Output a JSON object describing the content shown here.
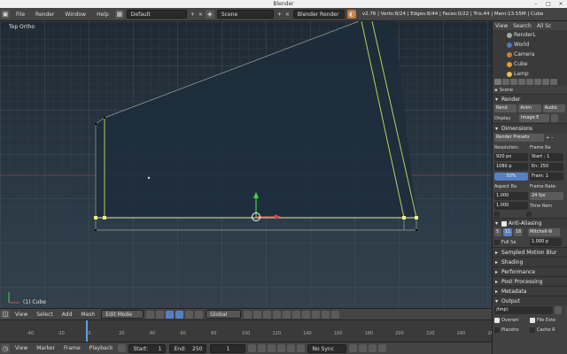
{
  "window": {
    "title": "Blender",
    "minimize": "–",
    "maximize": "□",
    "close": "×"
  },
  "topbar": {
    "menu": [
      "File",
      "Render",
      "Window",
      "Help"
    ],
    "layout": "Default",
    "scene": "Scene",
    "engine": "Blender Render",
    "stats": "v2.76 | Verts:8/24 | Edges:8/44 | Faces:0/22 | Tris:44 | Mem:13.55M | Cube"
  },
  "viewport": {
    "view_label": "Top Ortho",
    "object_label": "(1) Cube",
    "header": {
      "menu": [
        "View",
        "Select",
        "Add",
        "Mesh"
      ],
      "mode": "Edit Mode",
      "orientation": "Global"
    }
  },
  "timeline": {
    "ticks": [
      "-40",
      "-20",
      "0",
      "20",
      "40",
      "60",
      "80",
      "100",
      "120",
      "140",
      "160",
      "180",
      "200",
      "220",
      "240",
      "260"
    ],
    "header": {
      "menu": [
        "View",
        "Marker",
        "Frame",
        "Playback"
      ],
      "start": "Start:",
      "start_value": "1",
      "end": "End:",
      "end_value": "250",
      "current_frame": "1",
      "sync": "No Sync"
    }
  },
  "outliner": {
    "tabs": [
      "View",
      "Search",
      "All Sc"
    ],
    "rows": [
      "RenderL",
      "World",
      "Camera",
      "Cube",
      "Lamp"
    ],
    "colors": {
      "camera": "#c77b3a",
      "cube": "#e09a3a",
      "lamp": "#e0c24a",
      "world": "#4a7ac2",
      "render": "#9aa"
    }
  },
  "properties": {
    "context": "Scene",
    "render": {
      "title": "Render",
      "buttons": [
        "Rend",
        "Anim",
        "Audio"
      ],
      "display_label": "Display",
      "display_value": "Image E"
    },
    "dimensions": {
      "title": "Dimensions",
      "presets": "Render Presets",
      "resolution_label": "Resolution:",
      "res_x": "920 px",
      "res_y": "1080 p",
      "res_pct": "50%",
      "frame_range_label": "Frame Ra",
      "start": "Start : 1",
      "end": "En: 250",
      "step": "Fram: 1",
      "aspect_label": "Aspect Ra",
      "aspect_x": "1.000",
      "aspect_y": "1.000",
      "frame_rate_label": "Frame Rate:",
      "fps": "24 fps",
      "time_remap": "Time Rem"
    },
    "anti_aliasing": {
      "title": "Anti-Aliasing",
      "samples": [
        "5",
        "11",
        "16"
      ],
      "filter": "Mitchell-N",
      "full_sample": "Full Sa",
      "filter_size": "1.000 p"
    },
    "panels": [
      "Sampled Motion Blur",
      "Shading",
      "Performance",
      "Post Processing",
      "Metadata",
      "Output"
    ],
    "output": {
      "path": "/tmp\\",
      "overwrite": "Overwri",
      "file_ext": "File Exte",
      "placeholder": "Placeho",
      "cache": "Cache R"
    }
  }
}
